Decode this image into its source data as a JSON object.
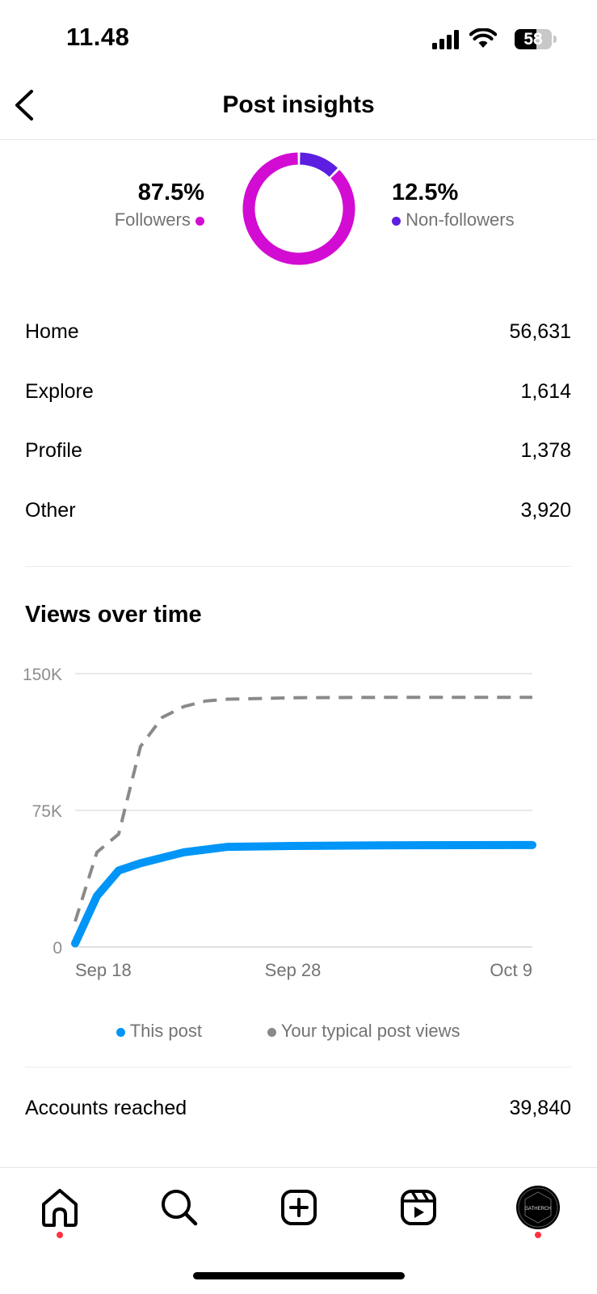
{
  "status_bar": {
    "time": "11.48",
    "battery": "58",
    "battery_level": 0.58,
    "icons": [
      "cellular-signal-icon",
      "wifi-icon",
      "battery-icon"
    ]
  },
  "header": {
    "title": "Post insights",
    "back_icon": "chevron-left-icon"
  },
  "audience": {
    "followers": {
      "percent": "87.5%",
      "label": "Followers",
      "value": 87.5,
      "color": "#d20cd3"
    },
    "non_followers": {
      "percent": "12.5%",
      "label": "Non-followers",
      "value": 12.5,
      "color": "#5c1ee0"
    }
  },
  "sources": [
    {
      "label": "Home",
      "value": "56,631"
    },
    {
      "label": "Explore",
      "value": "1,614"
    },
    {
      "label": "Profile",
      "value": "1,378"
    },
    {
      "label": "Other",
      "value": "3,920"
    }
  ],
  "views_over_time": {
    "title": "Views over time"
  },
  "chart_data": {
    "type": "line",
    "title": "Views over time",
    "x_tick_labels": [
      "Sep 18",
      "Sep 28",
      "Oct 9"
    ],
    "y_tick_labels": [
      "0",
      "75K",
      "150K"
    ],
    "ylim": [
      0,
      150000
    ],
    "xlim": [
      "Sep 18",
      "Oct 9"
    ],
    "grid": true,
    "legend_position": "bottom",
    "series": [
      {
        "name": "This post",
        "color": "#0095f6",
        "style": "solid",
        "x": [
          "Sep 18",
          "Sep 19",
          "Sep 20",
          "Sep 21",
          "Sep 22",
          "Sep 23",
          "Sep 25",
          "Sep 28",
          "Oct 2",
          "Oct 9"
        ],
        "values": [
          2000,
          28000,
          42000,
          46000,
          49000,
          52000,
          55000,
          55500,
          55800,
          56000
        ]
      },
      {
        "name": "Your typical post views",
        "color": "#8a8a8a",
        "style": "dashed",
        "x": [
          "Sep 18",
          "Sep 19",
          "Sep 20",
          "Sep 21",
          "Sep 22",
          "Sep 23",
          "Sep 24",
          "Sep 25",
          "Sep 28",
          "Oct 2",
          "Oct 9"
        ],
        "values": [
          14000,
          52000,
          62000,
          110000,
          126000,
          132000,
          135000,
          136000,
          136800,
          137000,
          137000
        ]
      }
    ]
  },
  "accounts_reached": {
    "label": "Accounts reached",
    "value": "39,840"
  },
  "bottom_nav": {
    "items": [
      "home-icon",
      "search-icon",
      "create-icon",
      "reels-icon",
      "profile-avatar"
    ],
    "avatar_text": "GATHERCH"
  }
}
